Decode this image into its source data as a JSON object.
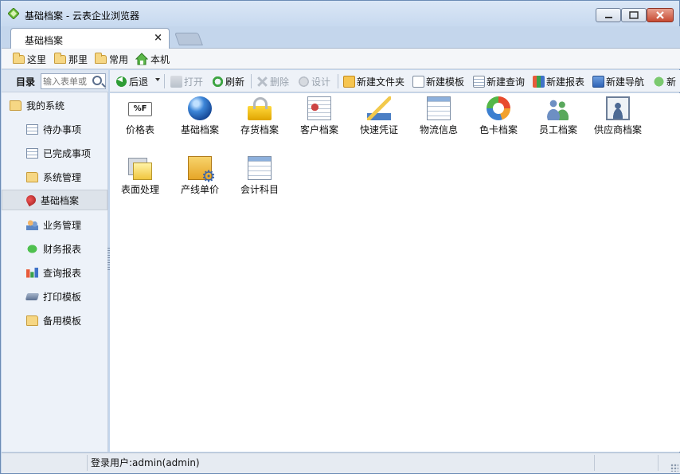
{
  "window": {
    "title": "基础档案 - 云表企业浏览器"
  },
  "tabs": {
    "active_label": "基础档案",
    "close_glyph": "×"
  },
  "bookmarks": [
    {
      "label": "这里",
      "icon": "folder-icon"
    },
    {
      "label": "那里",
      "icon": "folder-icon"
    },
    {
      "label": "常用",
      "icon": "folder-icon"
    },
    {
      "label": "本机",
      "icon": "home-icon"
    }
  ],
  "sidebar": {
    "title": "目录",
    "search_placeholder": "输入表单或",
    "root_label": "我的系统",
    "items": [
      {
        "label": "待办事项",
        "icon": "list-icon"
      },
      {
        "label": "已完成事项",
        "icon": "list-icon"
      },
      {
        "label": "系统管理",
        "icon": "folder-icon"
      },
      {
        "label": "基础档案",
        "icon": "pin-icon",
        "selected": true
      },
      {
        "label": "业务管理",
        "icon": "users-icon"
      },
      {
        "label": "财务报表",
        "icon": "money-icon"
      },
      {
        "label": "查询报表",
        "icon": "bar-chart-icon"
      },
      {
        "label": "打印模板",
        "icon": "printer-icon"
      },
      {
        "label": "备用模板",
        "icon": "folder-icon"
      }
    ]
  },
  "toolbar": {
    "back": "后退",
    "open": "打开",
    "refresh": "刷新",
    "delete": "删除",
    "design": "设计",
    "new_folder": "新建文件夹",
    "new_template": "新建模板",
    "new_query": "新建查询",
    "new_report": "新建报表",
    "new_nav": "新建导航",
    "new_more": "新"
  },
  "grid": {
    "price_badge": "%F",
    "items": [
      {
        "label": "价格表",
        "icon": "price-tag-icon"
      },
      {
        "label": "基础档案",
        "icon": "globe-icon"
      },
      {
        "label": "存货档案",
        "icon": "lock-icon"
      },
      {
        "label": "客户档案",
        "icon": "contact-card-icon"
      },
      {
        "label": "快速凭证",
        "icon": "ruler-icon"
      },
      {
        "label": "物流信息",
        "icon": "table-icon"
      },
      {
        "label": "色卡档案",
        "icon": "color-ring-icon"
      },
      {
        "label": "员工档案",
        "icon": "people-icon"
      },
      {
        "label": "供应商档案",
        "icon": "portrait-icon"
      },
      {
        "label": "表面处理",
        "icon": "layers-icon"
      },
      {
        "label": "产线单价",
        "icon": "gears-icon"
      },
      {
        "label": "会计科目",
        "icon": "table-icon"
      }
    ]
  },
  "status": {
    "user": "登录用户:admin(admin)"
  }
}
